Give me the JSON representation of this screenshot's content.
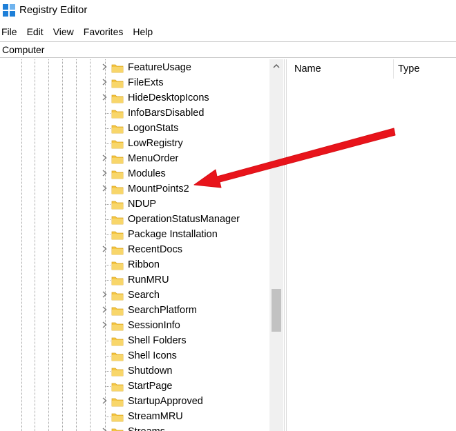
{
  "window": {
    "title": "Registry Editor"
  },
  "menu": [
    "File",
    "Edit",
    "View",
    "Favorites",
    "Help"
  ],
  "address": "Computer",
  "tree": {
    "items": [
      {
        "label": "FeatureUsage",
        "expandable": true
      },
      {
        "label": "FileExts",
        "expandable": true
      },
      {
        "label": "HideDesktopIcons",
        "expandable": true
      },
      {
        "label": "InfoBarsDisabled",
        "expandable": false
      },
      {
        "label": "LogonStats",
        "expandable": false
      },
      {
        "label": "LowRegistry",
        "expandable": false
      },
      {
        "label": "MenuOrder",
        "expandable": true
      },
      {
        "label": "Modules",
        "expandable": true
      },
      {
        "label": "MountPoints2",
        "expandable": true
      },
      {
        "label": "NDUP",
        "expandable": false
      },
      {
        "label": "OperationStatusManager",
        "expandable": false
      },
      {
        "label": "Package Installation",
        "expandable": false
      },
      {
        "label": "RecentDocs",
        "expandable": true
      },
      {
        "label": "Ribbon",
        "expandable": false
      },
      {
        "label": "RunMRU",
        "expandable": false
      },
      {
        "label": "Search",
        "expandable": true
      },
      {
        "label": "SearchPlatform",
        "expandable": true
      },
      {
        "label": "SessionInfo",
        "expandable": true
      },
      {
        "label": "Shell Folders",
        "expandable": false
      },
      {
        "label": "Shell Icons",
        "expandable": false
      },
      {
        "label": "Shutdown",
        "expandable": false
      },
      {
        "label": "StartPage",
        "expandable": false
      },
      {
        "label": "StartupApproved",
        "expandable": true
      },
      {
        "label": "StreamMRU",
        "expandable": false
      },
      {
        "label": "Streams",
        "expandable": true
      }
    ]
  },
  "list": {
    "columns": [
      "Name",
      "Type"
    ]
  },
  "icons": {
    "app": "registry-editor-icon",
    "folder": "folder-icon",
    "expand": "chevron-right-icon",
    "scroll_up": "scroll-up-arrow-icon"
  },
  "colors": {
    "folder": "#f4c542",
    "annotation_arrow": "#e8141b",
    "app_icon": "#1e7fd8"
  }
}
